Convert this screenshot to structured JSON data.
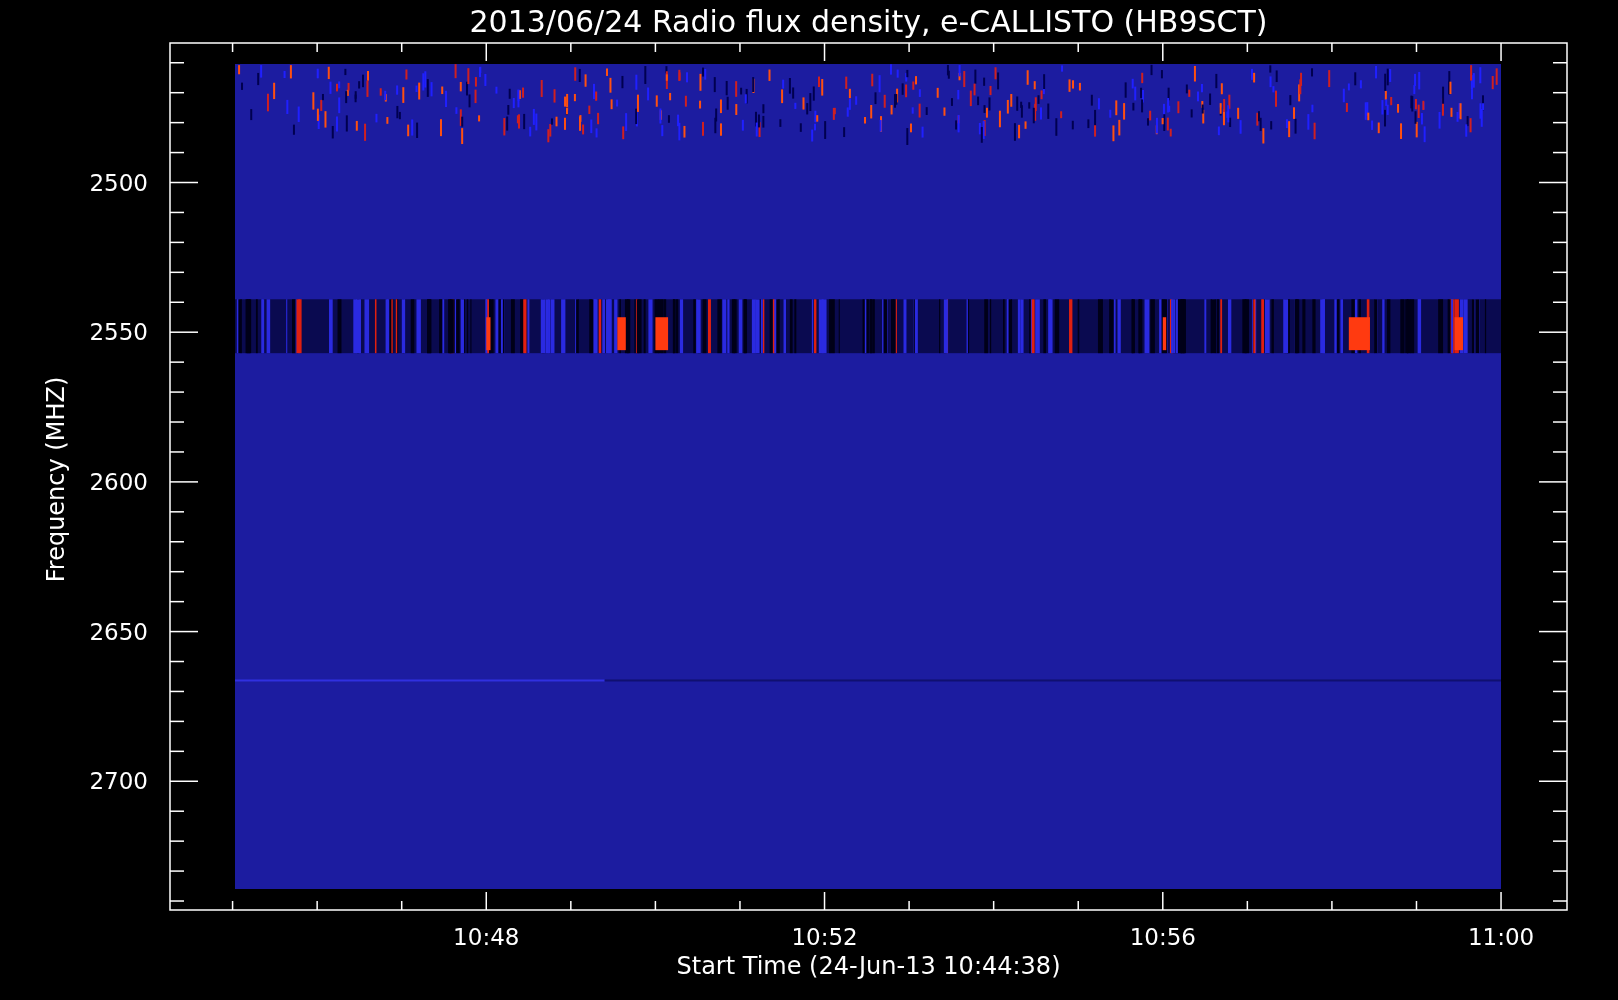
{
  "title": "2013/06/24  Radio flux density, e-CALLISTO (HB9SCT)",
  "y_axis": {
    "label": "Frequency (MHZ)",
    "ticks": [
      "2500",
      "2550",
      "2600",
      "2650",
      "2700"
    ]
  },
  "x_axis": {
    "label": "Start Time (24-Jun-13 10:44:38)",
    "ticks": [
      "10:48",
      "10:52",
      "10:56",
      "11:00"
    ]
  }
}
